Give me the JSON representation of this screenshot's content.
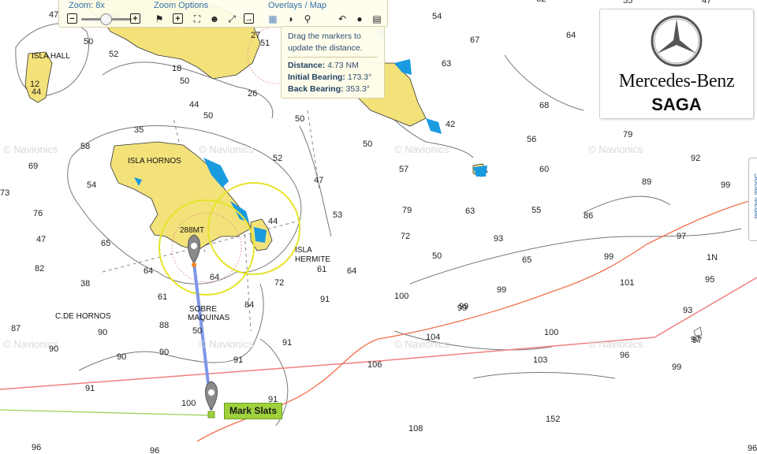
{
  "toolbar": {
    "zoom_label": "Zoom: 8x",
    "zoom_options_label": "Zoom Options",
    "overlays_label": "Overlays / Map"
  },
  "measure_popup": {
    "hint": "Drag the markers to update the distance.",
    "distance_label": "Distance:",
    "distance_value": "4.73 NM",
    "initial_bearing_label": "Initial Bearing:",
    "initial_bearing_value": "173.3°",
    "back_bearing_label": "Back Bearing:",
    "back_bearing_value": "353.3°"
  },
  "brand": {
    "name": "Mercedes-Benz",
    "sub": "SAGA"
  },
  "social_tab": {
    "label": "Social Media"
  },
  "boat": {
    "label": "Mark Slats"
  },
  "map": {
    "place_names": {
      "isla_hall": "ISLA HALL",
      "isla_hornos": "ISLA HORNOS",
      "isla_hermite_1": "ISLA",
      "isla_hermite_2": "HERMITE",
      "sobre_maquinas_1": "SOBRE",
      "sobre_maquinas_2": "MAQUINAS",
      "cde_hornos": "C.DE HORNOS",
      "height_mark": "288MT"
    },
    "watermark": "© Navionics",
    "depths": [
      "47",
      "52",
      "62",
      "55",
      "47",
      "50",
      "52",
      "50",
      "44",
      "54",
      "18",
      "27",
      "51",
      "26",
      "12",
      "44",
      "50",
      "50",
      "63",
      "68",
      "64",
      "67",
      "42",
      "35",
      "69",
      "58",
      "57",
      "56",
      "50",
      "79",
      "92",
      "99",
      "60",
      "54",
      "73",
      "76",
      "52",
      "47",
      "53",
      "79",
      "63",
      "55",
      "86",
      "89",
      "47",
      "65",
      "82",
      "64",
      "61",
      "44",
      "72",
      "50",
      "93",
      "65",
      "99",
      "97",
      "1N",
      "38",
      "64",
      "72",
      "84",
      "61",
      "64",
      "91",
      "100",
      "99",
      "95",
      "101",
      "88",
      "87",
      "90",
      "50",
      "91",
      "104",
      "100",
      "93",
      "97",
      "90",
      "99",
      "106",
      "103",
      "96",
      "99",
      "91",
      "91",
      "100",
      "91",
      "152",
      "108",
      "96",
      "90",
      "90",
      "96",
      "99",
      "97",
      "96"
    ]
  },
  "colors": {
    "land": "#f3e27a",
    "shallow": "#1a9be0",
    "route_line": "#7d96e8",
    "orange_contour": "#f26f4a",
    "red_line": "#f08080",
    "green_line": "#9ed35a",
    "range_ring": "#e6e42a"
  }
}
